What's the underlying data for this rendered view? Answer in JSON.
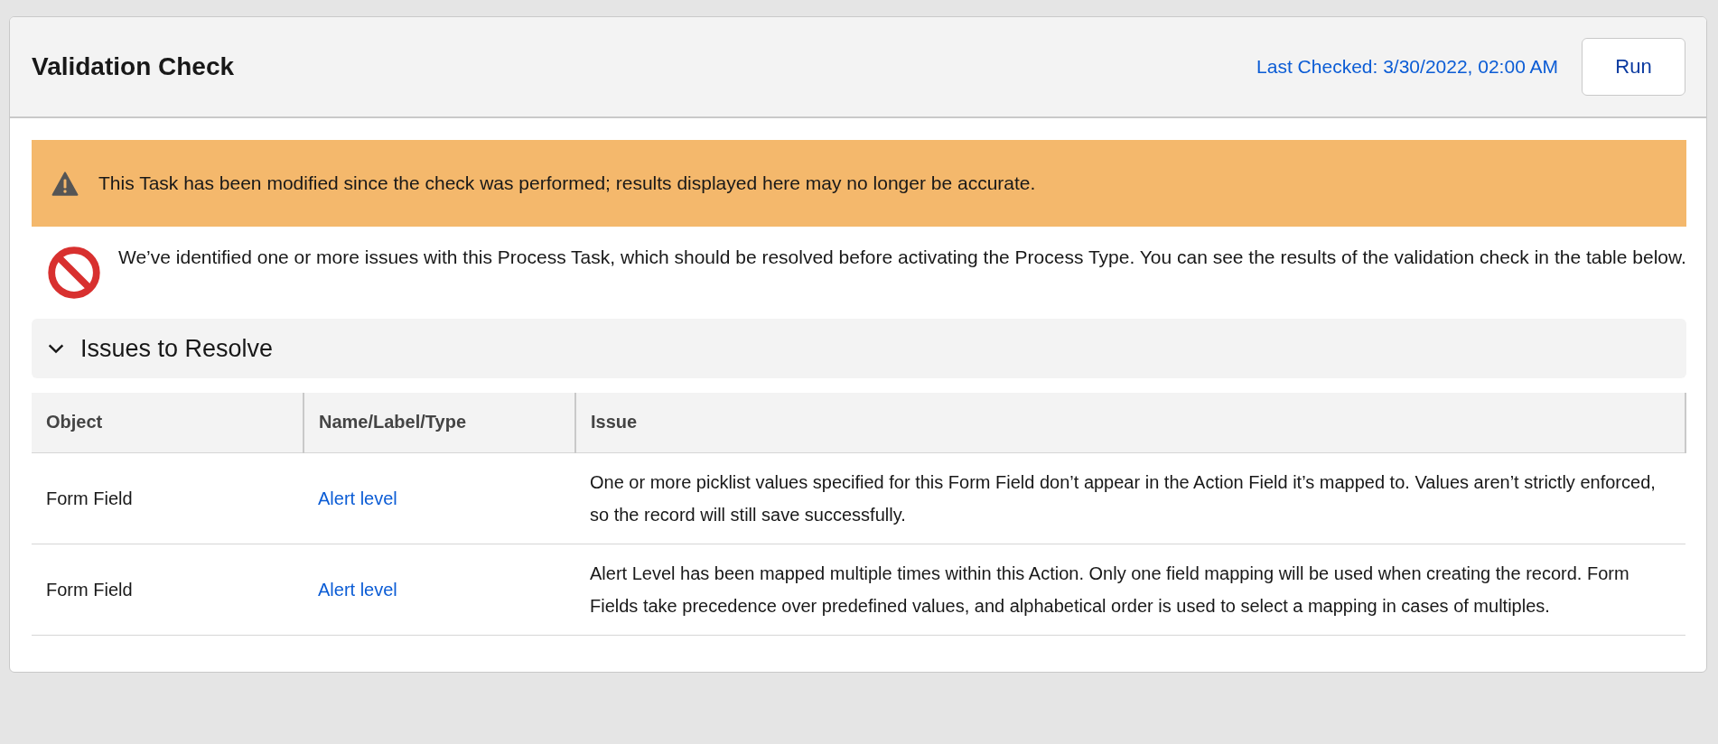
{
  "card": {
    "title": "Validation Check",
    "last_checked": "Last Checked: 3/30/2022, 02:00 AM",
    "run_button": "Run"
  },
  "warning": {
    "text": "This Task has been modified since the check was performed; results displayed here may no longer be accurate."
  },
  "error": {
    "text": "We’ve identified one or more issues with this Process Task, which should be resolved before activating the Process Type. You can see the results of the validation check in the table below."
  },
  "section": {
    "title": "Issues to Resolve",
    "expanded": true
  },
  "table": {
    "columns": [
      "Object",
      "Name/Label/Type",
      "Issue"
    ],
    "rows": [
      {
        "object": "Form Field",
        "name": "Alert level",
        "issue": "One or more picklist values specified for this Form Field don’t appear in the Action Field it’s mapped to. Values aren’t strictly enforced, so the record will still save successfully."
      },
      {
        "object": "Form Field",
        "name": "Alert level",
        "issue": "Alert Level has been mapped multiple times within this Action. Only one field mapping will be used when creating the record. Form Fields take precedence over predefined values, and alphabetical order is used to select a mapping in cases of multiples."
      }
    ]
  }
}
